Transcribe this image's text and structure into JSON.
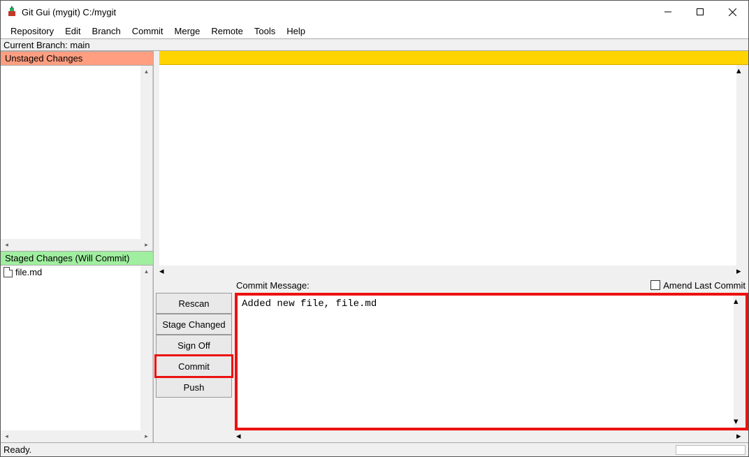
{
  "window": {
    "title": "Git Gui (mygit) C:/mygit"
  },
  "menubar": {
    "items": [
      "Repository",
      "Edit",
      "Branch",
      "Commit",
      "Merge",
      "Remote",
      "Tools",
      "Help"
    ]
  },
  "branch_line": "Current Branch: main",
  "panes": {
    "unstaged_header": "Unstaged Changes",
    "staged_header": "Staged Changes (Will Commit)",
    "staged_files": [
      {
        "name": "file.md"
      }
    ]
  },
  "commit": {
    "label": "Commit Message:",
    "amend_label": "Amend Last Commit",
    "buttons": {
      "rescan": "Rescan",
      "stage_changed": "Stage Changed",
      "sign_off": "Sign Off",
      "commit": "Commit",
      "push": "Push"
    },
    "message": "Added new file, file.md"
  },
  "status": "Ready.",
  "highlight": {
    "commit_button": true,
    "message_box": true
  }
}
